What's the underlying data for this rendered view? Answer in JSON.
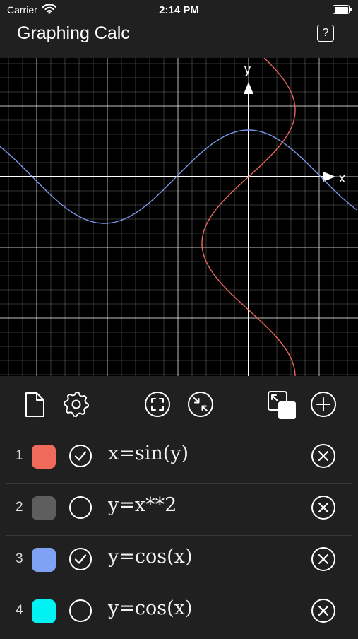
{
  "status": {
    "carrier": "Carrier",
    "time": "2:14 PM"
  },
  "header": {
    "title": "Graphing Calc",
    "help_label": "?"
  },
  "graph": {
    "x_axis_label": "x",
    "y_axis_label": "y",
    "background": "#000000",
    "grid_color": "#ffffff",
    "curves": [
      {
        "expression": "y=cos(x)",
        "color": "#7b98e8"
      },
      {
        "expression": "x=sin(y)",
        "color": "#e8675a"
      }
    ]
  },
  "toolbar": {
    "icons": [
      "new-document-icon",
      "settings-gear-icon",
      "fit-view-icon",
      "zoom-in-icon",
      "layers-icon",
      "add-icon"
    ]
  },
  "functions": [
    {
      "index": "1",
      "color": "#ef6a5a",
      "checked": true,
      "expression": "x=sin(y)"
    },
    {
      "index": "2",
      "color": "#5e5e5e",
      "checked": false,
      "expression": "y=x**2"
    },
    {
      "index": "3",
      "color": "#7fa2f5",
      "checked": true,
      "expression": "y=cos(x)"
    },
    {
      "index": "4",
      "color": "#00f2f2",
      "checked": false,
      "expression": "y=cos(x)"
    }
  ]
}
